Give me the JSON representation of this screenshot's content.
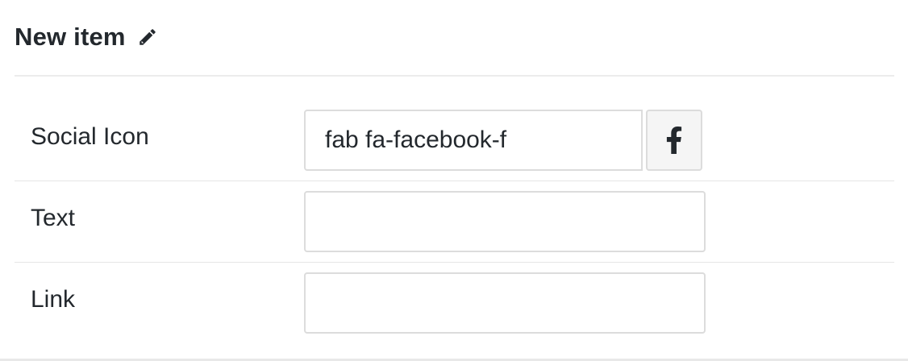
{
  "header": {
    "title": "New item",
    "edit_icon": "pencil-icon"
  },
  "fields": {
    "social_icon": {
      "label": "Social Icon",
      "value": "fab fa-facebook-f",
      "preview_icon": "facebook-f-icon"
    },
    "text": {
      "label": "Text",
      "value": ""
    },
    "link": {
      "label": "Link",
      "value": ""
    }
  },
  "colors": {
    "text": "#23282d",
    "border": "#dcdcdc",
    "preview_bg": "#f5f5f5",
    "divider": "#e6e6e6"
  }
}
